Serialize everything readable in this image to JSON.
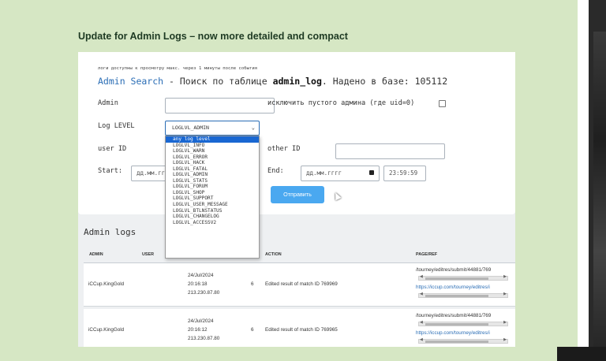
{
  "post": {
    "title": "Update for Admin Logs – now more detailed and compact"
  },
  "search": {
    "note": "логи доступны к просмотру макс. через 1 минуты после события",
    "title_link": "Admin Search",
    "title_rest": " - Поиск по таблице ",
    "table_name": "admin_log",
    "found_text": ". Надено в базе: 105112",
    "admin_label": "Admin",
    "exclude_label": "исключить пустого админа (где uid=0)",
    "log_level_label": "Log LEVEL",
    "log_level_value": "LOGLVL_ADMIN",
    "user_id_label": "user ID",
    "other_id_label": "other ID",
    "start_label": "Start:",
    "end_label": "End:",
    "start_date_placeholder": "дд.мм.гггг",
    "end_date_placeholder": "дд.мм.гггг",
    "end_time": "23:59:59",
    "submit_label": "Отправить"
  },
  "dropdown": {
    "options": [
      "any log level",
      "LOGLVL_INFO",
      "LOGLVL_WARN",
      "LOGLVL_ERROR",
      "LOGLVL_HACK",
      "LOGLVL_FATAL",
      "LOGLVL_ADMIN",
      "LOGLVL_STATS",
      "LOGLVL_FORUM",
      "LOGLVL_SHOP",
      "LOGLVL_SUPPORT",
      "LOGLVL_USER_MESSAGE",
      "LOGLVL_BTLNSTATUS",
      "LOGLVL_CHANGELOG",
      "LOGLVL_ACCESSV2"
    ],
    "highlighted": "any log level"
  },
  "logs": {
    "title": "Admin logs",
    "columns": {
      "admin": "ADMIN",
      "user": "USER",
      "action": "ACTION",
      "page": "PAGE/REF"
    },
    "rows": [
      {
        "admin": "iCCup.KingGold",
        "date": "24/Jul/2024",
        "time": "20:16:18",
        "ip": "213.230.87.80",
        "level": "6",
        "action": "Edited result of match ID 769969",
        "page": "/tourney/editres/submit/44881/769",
        "ref": "https://iccup.com/tourney/editres/i"
      },
      {
        "admin": "iCCup.KingGold",
        "date": "24/Jul/2024",
        "time": "20:16:12",
        "ip": "213.230.87.80",
        "level": "6",
        "action": "Edited result of match ID 769965",
        "page": "/tourney/editres/submit/44881/769",
        "ref": "https://iccup.com/tourney/editres/i"
      }
    ]
  },
  "colors": {
    "background": "#d6e7c4",
    "link": "#2a6db5",
    "button": "#4aa8f0",
    "highlight": "#1967d2"
  }
}
